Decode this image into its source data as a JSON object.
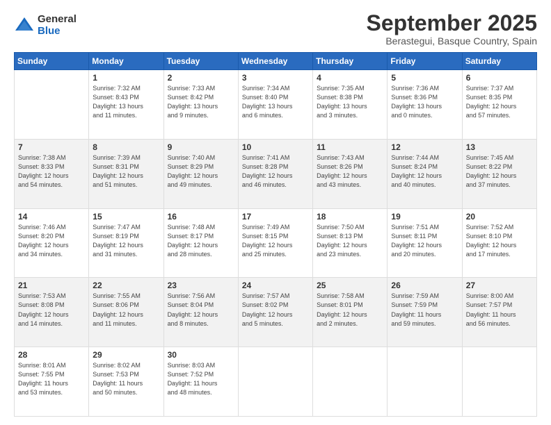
{
  "logo": {
    "general": "General",
    "blue": "Blue"
  },
  "header": {
    "month": "September 2025",
    "location": "Berastegui, Basque Country, Spain"
  },
  "weekdays": [
    "Sunday",
    "Monday",
    "Tuesday",
    "Wednesday",
    "Thursday",
    "Friday",
    "Saturday"
  ],
  "weeks": [
    [
      {
        "day": "",
        "info": ""
      },
      {
        "day": "1",
        "info": "Sunrise: 7:32 AM\nSunset: 8:43 PM\nDaylight: 13 hours\nand 11 minutes."
      },
      {
        "day": "2",
        "info": "Sunrise: 7:33 AM\nSunset: 8:42 PM\nDaylight: 13 hours\nand 9 minutes."
      },
      {
        "day": "3",
        "info": "Sunrise: 7:34 AM\nSunset: 8:40 PM\nDaylight: 13 hours\nand 6 minutes."
      },
      {
        "day": "4",
        "info": "Sunrise: 7:35 AM\nSunset: 8:38 PM\nDaylight: 13 hours\nand 3 minutes."
      },
      {
        "day": "5",
        "info": "Sunrise: 7:36 AM\nSunset: 8:36 PM\nDaylight: 13 hours\nand 0 minutes."
      },
      {
        "day": "6",
        "info": "Sunrise: 7:37 AM\nSunset: 8:35 PM\nDaylight: 12 hours\nand 57 minutes."
      }
    ],
    [
      {
        "day": "7",
        "info": "Sunrise: 7:38 AM\nSunset: 8:33 PM\nDaylight: 12 hours\nand 54 minutes."
      },
      {
        "day": "8",
        "info": "Sunrise: 7:39 AM\nSunset: 8:31 PM\nDaylight: 12 hours\nand 51 minutes."
      },
      {
        "day": "9",
        "info": "Sunrise: 7:40 AM\nSunset: 8:29 PM\nDaylight: 12 hours\nand 49 minutes."
      },
      {
        "day": "10",
        "info": "Sunrise: 7:41 AM\nSunset: 8:28 PM\nDaylight: 12 hours\nand 46 minutes."
      },
      {
        "day": "11",
        "info": "Sunrise: 7:43 AM\nSunset: 8:26 PM\nDaylight: 12 hours\nand 43 minutes."
      },
      {
        "day": "12",
        "info": "Sunrise: 7:44 AM\nSunset: 8:24 PM\nDaylight: 12 hours\nand 40 minutes."
      },
      {
        "day": "13",
        "info": "Sunrise: 7:45 AM\nSunset: 8:22 PM\nDaylight: 12 hours\nand 37 minutes."
      }
    ],
    [
      {
        "day": "14",
        "info": "Sunrise: 7:46 AM\nSunset: 8:20 PM\nDaylight: 12 hours\nand 34 minutes."
      },
      {
        "day": "15",
        "info": "Sunrise: 7:47 AM\nSunset: 8:19 PM\nDaylight: 12 hours\nand 31 minutes."
      },
      {
        "day": "16",
        "info": "Sunrise: 7:48 AM\nSunset: 8:17 PM\nDaylight: 12 hours\nand 28 minutes."
      },
      {
        "day": "17",
        "info": "Sunrise: 7:49 AM\nSunset: 8:15 PM\nDaylight: 12 hours\nand 25 minutes."
      },
      {
        "day": "18",
        "info": "Sunrise: 7:50 AM\nSunset: 8:13 PM\nDaylight: 12 hours\nand 23 minutes."
      },
      {
        "day": "19",
        "info": "Sunrise: 7:51 AM\nSunset: 8:11 PM\nDaylight: 12 hours\nand 20 minutes."
      },
      {
        "day": "20",
        "info": "Sunrise: 7:52 AM\nSunset: 8:10 PM\nDaylight: 12 hours\nand 17 minutes."
      }
    ],
    [
      {
        "day": "21",
        "info": "Sunrise: 7:53 AM\nSunset: 8:08 PM\nDaylight: 12 hours\nand 14 minutes."
      },
      {
        "day": "22",
        "info": "Sunrise: 7:55 AM\nSunset: 8:06 PM\nDaylight: 12 hours\nand 11 minutes."
      },
      {
        "day": "23",
        "info": "Sunrise: 7:56 AM\nSunset: 8:04 PM\nDaylight: 12 hours\nand 8 minutes."
      },
      {
        "day": "24",
        "info": "Sunrise: 7:57 AM\nSunset: 8:02 PM\nDaylight: 12 hours\nand 5 minutes."
      },
      {
        "day": "25",
        "info": "Sunrise: 7:58 AM\nSunset: 8:01 PM\nDaylight: 12 hours\nand 2 minutes."
      },
      {
        "day": "26",
        "info": "Sunrise: 7:59 AM\nSunset: 7:59 PM\nDaylight: 11 hours\nand 59 minutes."
      },
      {
        "day": "27",
        "info": "Sunrise: 8:00 AM\nSunset: 7:57 PM\nDaylight: 11 hours\nand 56 minutes."
      }
    ],
    [
      {
        "day": "28",
        "info": "Sunrise: 8:01 AM\nSunset: 7:55 PM\nDaylight: 11 hours\nand 53 minutes."
      },
      {
        "day": "29",
        "info": "Sunrise: 8:02 AM\nSunset: 7:53 PM\nDaylight: 11 hours\nand 50 minutes."
      },
      {
        "day": "30",
        "info": "Sunrise: 8:03 AM\nSunset: 7:52 PM\nDaylight: 11 hours\nand 48 minutes."
      },
      {
        "day": "",
        "info": ""
      },
      {
        "day": "",
        "info": ""
      },
      {
        "day": "",
        "info": ""
      },
      {
        "day": "",
        "info": ""
      }
    ]
  ]
}
